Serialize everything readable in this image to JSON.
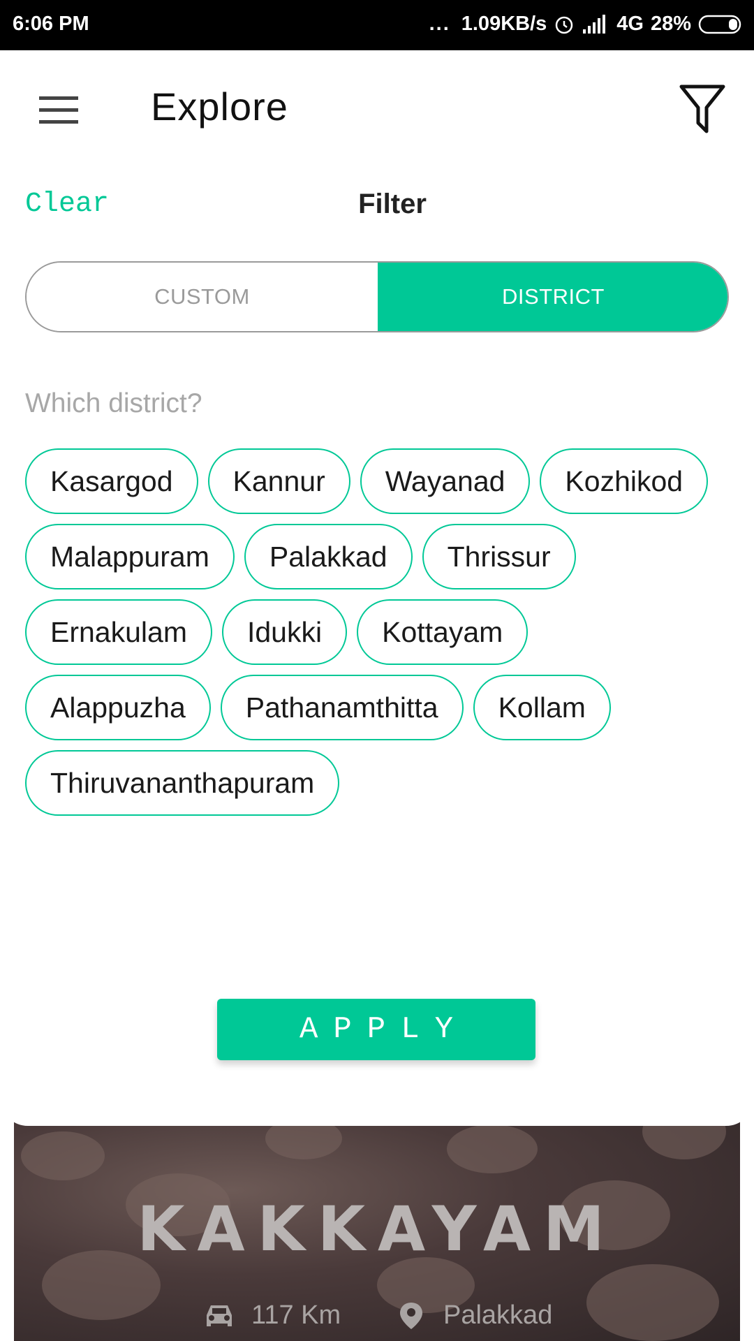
{
  "status_bar": {
    "time": "6:06 PM",
    "dots": "...",
    "network_speed": "1.09KB/s",
    "network_type": "4G",
    "battery": "28%"
  },
  "app_bar": {
    "title": "Explore",
    "menu_icon": "hamburger-menu-icon",
    "filter_icon": "funnel-filter-icon"
  },
  "filter": {
    "clear_label": "Clear",
    "heading": "Filter",
    "tabs": [
      {
        "label": "CUSTOM",
        "selected": false
      },
      {
        "label": "DISTRICT",
        "selected": true
      }
    ],
    "question": "Which district?",
    "districts": [
      [
        "Kasargod",
        "Kannur",
        "Wayanad",
        "Kozhikod"
      ],
      [
        "Malappuram",
        "Palakkad",
        "Thrissur"
      ],
      [
        "Ernakulam",
        "Idukki",
        "Kottayam"
      ],
      [
        "Alappuzha",
        "Pathanamthitta",
        "Kollam"
      ],
      [
        "Thiruvananthapuram"
      ]
    ],
    "apply_label": "APPLY"
  },
  "background_card": {
    "place": "KAKKAYAM",
    "distance": "117 Km",
    "district": "Palakkad"
  },
  "colors": {
    "accent": "#00c896",
    "status_bar": "#000000"
  }
}
